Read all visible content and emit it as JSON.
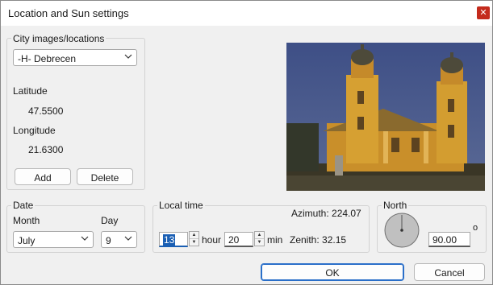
{
  "window": {
    "title": "Location and Sun settings"
  },
  "city_group": {
    "legend": "City images/locations",
    "selected_city": "-H-  Debrecen",
    "latitude_label": "Latitude",
    "latitude_value": "47.5500",
    "longitude_label": "Longitude",
    "longitude_value": "21.6300",
    "add_label": "Add",
    "delete_label": "Delete"
  },
  "date_group": {
    "legend": "Date",
    "month_label": "Month",
    "month_value": "July",
    "day_label": "Day",
    "day_value": "9"
  },
  "time_group": {
    "legend": "Local time",
    "hour_value": "13",
    "hour_unit": "hour",
    "min_value": "20",
    "min_unit": "min",
    "azimuth_text": "Azimuth: 224.07",
    "zenith_text": "Zenith: 32.15"
  },
  "north_group": {
    "legend": "North",
    "value": "90.00",
    "degree_symbol": "o"
  },
  "buttons": {
    "ok_label": "OK",
    "cancel_label": "Cancel"
  },
  "icons": {
    "close": "close-icon",
    "dropdown": "chevron-down-icon",
    "spin_up": "spin-up-icon",
    "spin_down": "spin-down-icon"
  },
  "colors": {
    "accent": "#1a5fb4",
    "close": "#c42b1c",
    "dial": "#c0c0c0"
  }
}
